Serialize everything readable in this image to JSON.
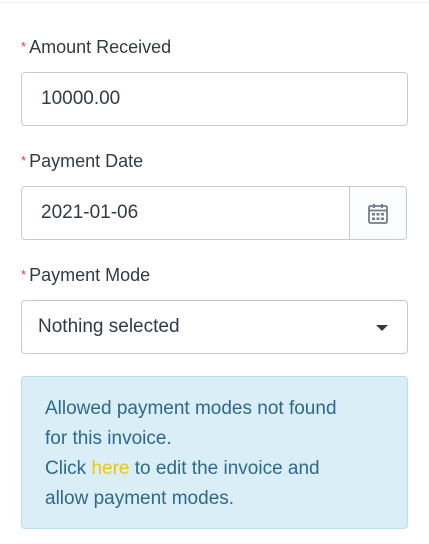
{
  "form": {
    "amount": {
      "required_mark": "*",
      "label": "Amount Received",
      "value": "10000.00"
    },
    "date": {
      "required_mark": "*",
      "label": "Payment Date",
      "value": "2021-01-06",
      "icon": "calendar-icon"
    },
    "mode": {
      "required_mark": "*",
      "label": "Payment Mode",
      "selected": "Nothing selected",
      "icon": "caret-down-icon"
    }
  },
  "alert": {
    "line1": "Allowed payment modes not found",
    "line2": "for this invoice.",
    "click": "Click",
    "link": "here",
    "after_link": "to edit the invoice and",
    "line4": "allow payment modes."
  },
  "colors": {
    "required": "#e43c3c",
    "alert_bg": "#d9eef6",
    "alert_text": "#2f6989",
    "link": "#f1c40f"
  }
}
